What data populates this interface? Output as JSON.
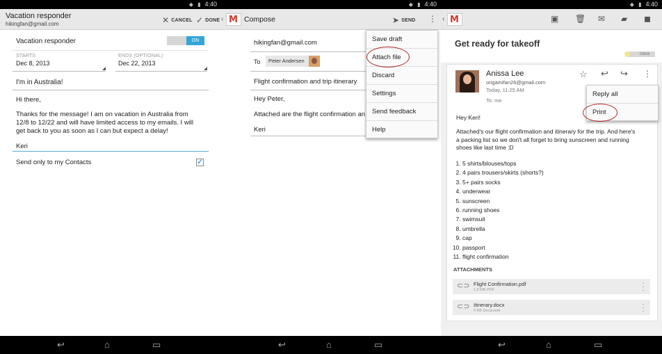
{
  "status": {
    "time": "4:40"
  },
  "vacation": {
    "title": "Vacation responder",
    "account": "hikingfan@gmail.com",
    "cancel_label": "CANCEL",
    "done_label": "DONE",
    "responder_label": "Vacation responder",
    "toggle_label": "ON",
    "starts_label": "STARTS",
    "starts_value": "Dec 8, 2013",
    "ends_label": "ENDS (OPTIONAL)",
    "ends_value": "Dec 22, 2013",
    "subject": "I'm in Australia!",
    "message_lines": [
      "Hi there,",
      "Thanks for the message! I am on vacation in Australia from",
      "12/8 to 12/22 and will have limited access to my emails. I will",
      "get back to you as soon as I can but expect a delay!",
      "Keri"
    ],
    "contacts_label": "Send only to my Contacts",
    "contacts_checked": true
  },
  "compose": {
    "title": "Compose",
    "send_label": "SEND",
    "from": "hikingfan@gmail.com",
    "to_label": "To",
    "recipient": "Peter Andersen",
    "subject": "Flight confirmation and trip itinerary",
    "body_lines": [
      "Hey Peter,",
      "Attached are the flight confirmation an",
      "Keri"
    ],
    "menu": [
      "Save draft",
      "Attach file",
      "Discard",
      "Settings",
      "Send feedback",
      "Help"
    ]
  },
  "message": {
    "subject": "Get ready for takeoff",
    "label": "Inbox",
    "sender_name": "Anissa Lee",
    "sender_email": "origamifan26@gmail.com",
    "date": "Today, 11:25 AM",
    "to": "To: me",
    "menu": [
      "Reply all",
      "Print"
    ],
    "greeting": "Hey Keri!",
    "body_lines": [
      "Attached's our flight confirmation and itinerary for the trip. And here's",
      "a packing list so we don't all forget to bring sunscreen and running",
      "shoes like last time :D"
    ],
    "list": [
      "5 shirts/blouses/tops",
      "4 pairs trousers/skirts (shorts?)",
      "5+ pairs socks",
      "underwear",
      "sunscreen",
      "running shoes",
      "swimsuit",
      "umbrella",
      "cap",
      "passport",
      "flight confirmation"
    ],
    "attachments_label": "ATTACHMENTS",
    "attachments": [
      {
        "name": "Flight Confirmation.pdf",
        "size": "1.8 MB PDF"
      },
      {
        "name": "Itinerary.docx",
        "size": "9 KB Document"
      }
    ]
  },
  "colors": {
    "accent": "#33a6d8",
    "brand_red": "#d23a2e",
    "highlight_circle": "#b42a2a"
  }
}
